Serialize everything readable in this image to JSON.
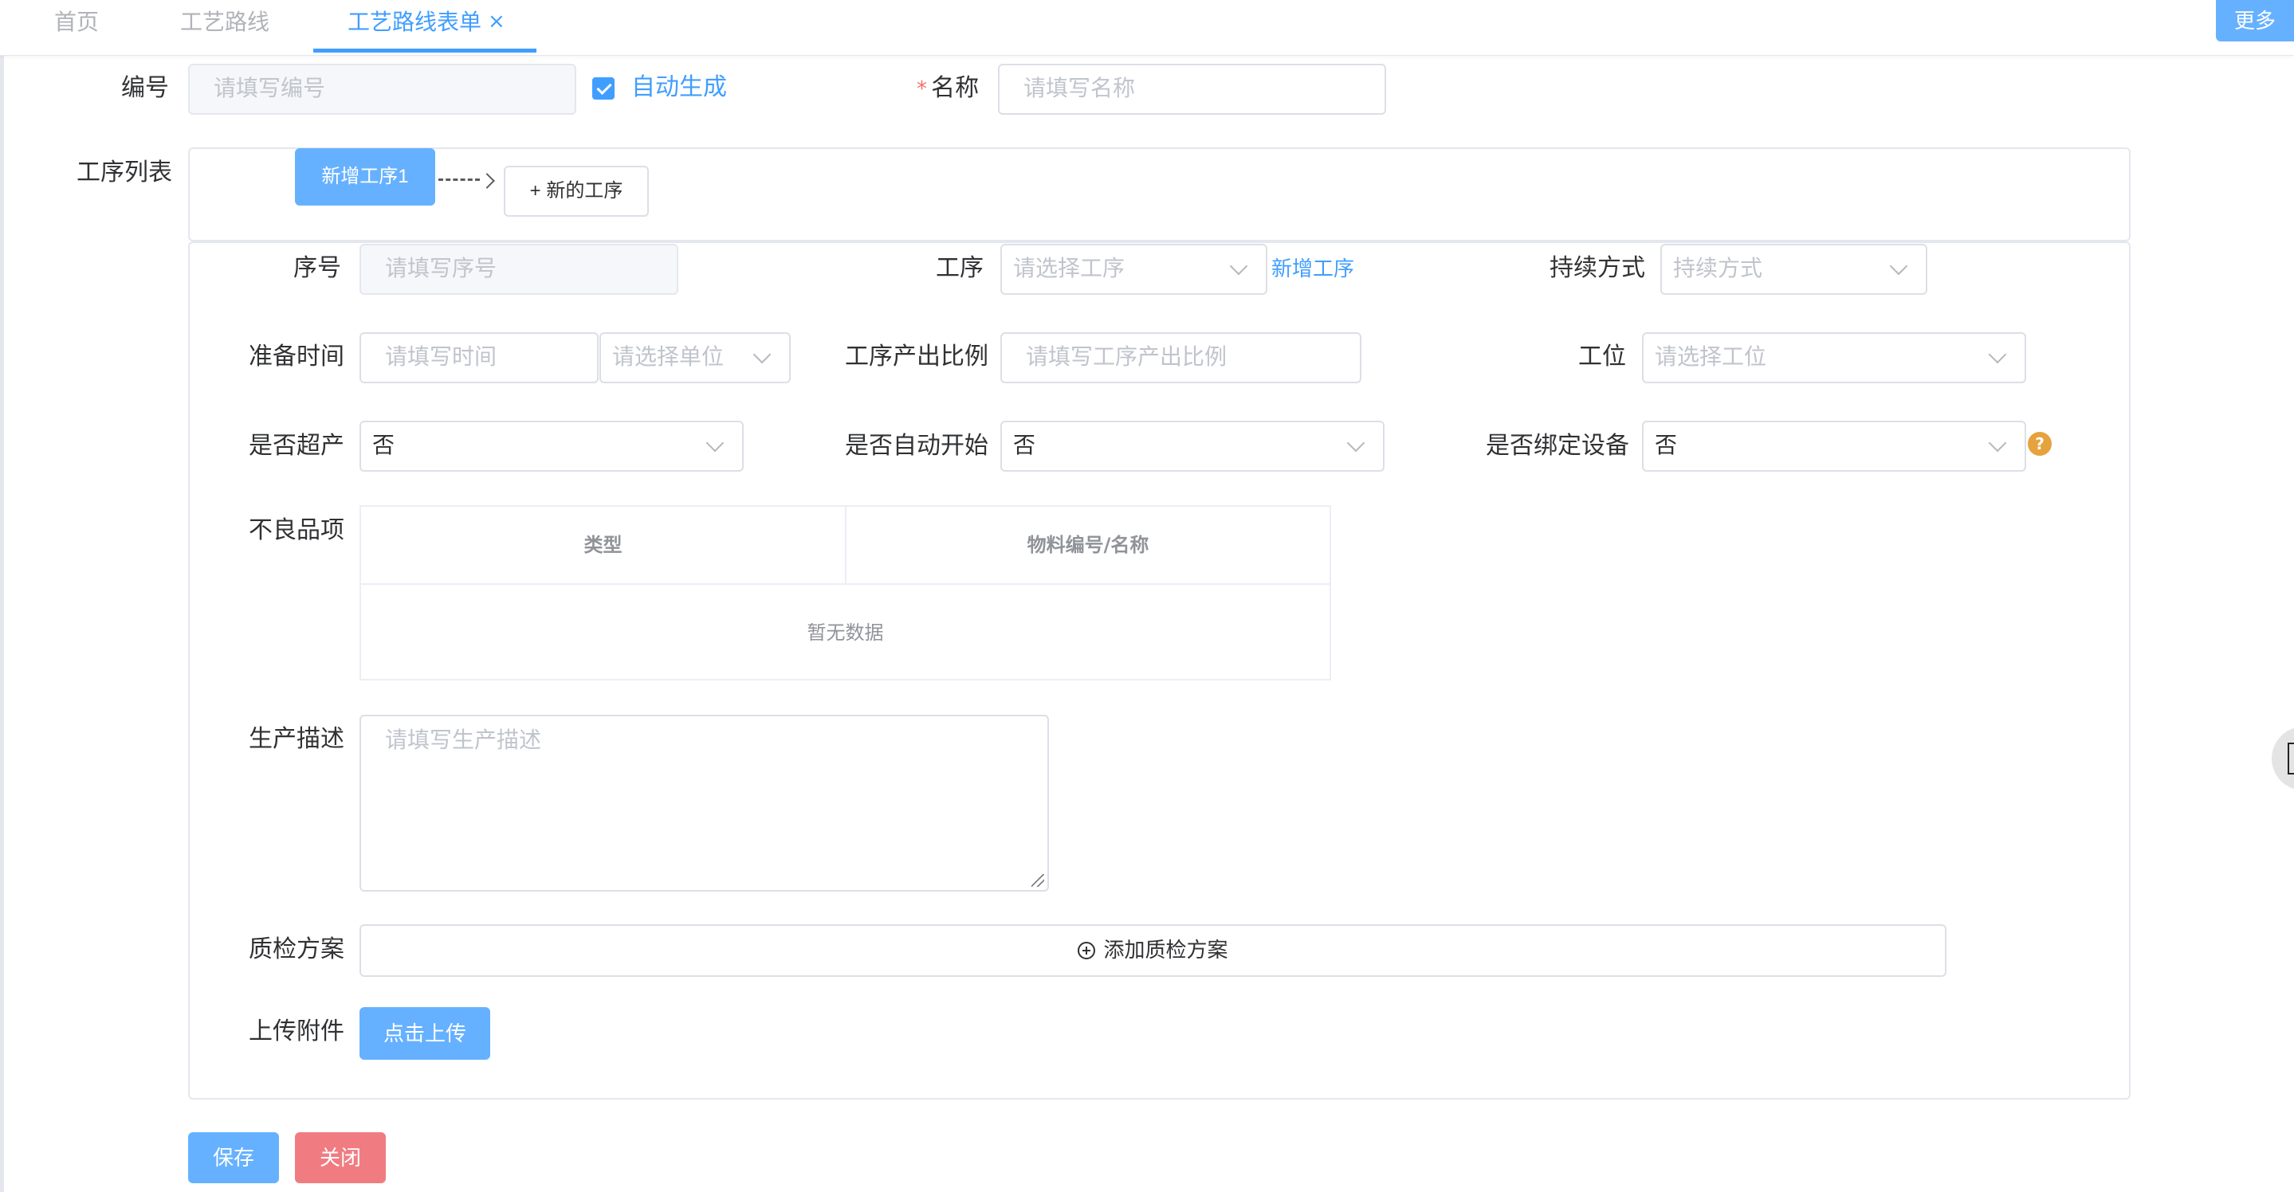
{
  "tabs": [
    {
      "label": "首页"
    },
    {
      "label": "工艺路线"
    },
    {
      "label": "工艺路线表单"
    }
  ],
  "more_label": "更多",
  "code": {
    "label": "编号",
    "placeholder": "请填写编号",
    "auto_label": "自动生成",
    "auto_checked": true
  },
  "name": {
    "required_mark": "*",
    "label": "名称",
    "placeholder": "请填写名称"
  },
  "process_list": {
    "label": "工序列表",
    "steps": [
      {
        "label": "新增工序1"
      }
    ],
    "new_step_label": "+ 新的工序"
  },
  "detail": {
    "seq": {
      "label": "序号",
      "placeholder": "请填写序号"
    },
    "process": {
      "label": "工序",
      "placeholder": "请选择工序",
      "add_link": "新增工序"
    },
    "duration_mode": {
      "label": "持续方式",
      "placeholder": "持续方式"
    },
    "prep_time": {
      "label": "准备时间",
      "placeholder": "请填写时间",
      "unit_placeholder": "请选择单位"
    },
    "output_ratio": {
      "label": "工序产出比例",
      "placeholder": "请填写工序产出比例"
    },
    "station": {
      "label": "工位",
      "placeholder": "请选择工位"
    },
    "over_production": {
      "label": "是否超产",
      "value": "否"
    },
    "auto_start": {
      "label": "是否自动开始",
      "value": "否"
    },
    "bind_device": {
      "label": "是否绑定设备",
      "value": "否",
      "help": "?"
    },
    "defects": {
      "label": "不良品项",
      "columns": [
        "类型",
        "物料编号/名称"
      ],
      "empty_text": "暂无数据"
    },
    "description": {
      "label": "生产描述",
      "placeholder": "请填写生产描述"
    },
    "qc": {
      "label": "质检方案",
      "button": "添加质检方案"
    },
    "attachment": {
      "label": "上传附件",
      "button": "点击上传"
    }
  },
  "actions": {
    "save": "保存",
    "close": "关闭"
  },
  "colors": {
    "primary": "#409eff",
    "danger": "#f56c6c",
    "warning": "#e6a23c"
  }
}
